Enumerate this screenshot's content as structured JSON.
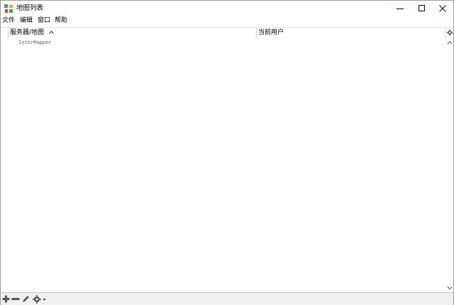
{
  "window": {
    "title": "地图列表",
    "icon": "map-list-icon"
  },
  "menubar": {
    "items": [
      "文件",
      "编辑",
      "窗口",
      "帮助"
    ]
  },
  "table": {
    "columns": [
      {
        "label": "服务器/地图",
        "sort": "ascending"
      },
      {
        "label": "当前用户"
      }
    ],
    "rows": [
      {
        "server": "InterMapper",
        "user": ""
      }
    ]
  },
  "toolbar": {
    "buttons": [
      "add-icon",
      "remove-icon",
      "edit-icon",
      "gear-menu-icon"
    ]
  }
}
